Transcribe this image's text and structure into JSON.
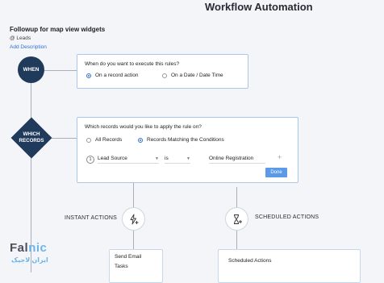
{
  "header": {
    "title": "Workflow Automation"
  },
  "rule": {
    "name": "Followup for map view widgets",
    "module": "@ Leads",
    "add_description": "Add Description"
  },
  "when": {
    "node_label": "WHEN",
    "question": "When do you want to execute this rules?",
    "options": [
      {
        "label": "On a record action",
        "selected": true
      },
      {
        "label": "On a Date / Date Time",
        "selected": false
      }
    ]
  },
  "which_records": {
    "node_label_line1": "WHICH",
    "node_label_line2": "RECORDS",
    "question": "Which records would you like to apply the rule on?",
    "options": [
      {
        "label": "All Records",
        "selected": false
      },
      {
        "label": "Records Matching the Conditions",
        "selected": true
      }
    ],
    "condition": {
      "number": "1",
      "field": "Lead Source",
      "operator": "is",
      "value": "Online Registration"
    },
    "add_label": "+",
    "done_label": "Done"
  },
  "instant_actions": {
    "label": "INSTANT ACTIONS",
    "items": [
      "Send Email",
      "Tasks"
    ]
  },
  "scheduled_actions": {
    "label": "SCHEDULED ACTIONS",
    "items": [
      "Scheduled Actions"
    ]
  },
  "watermark": {
    "latin_part1": "Fal",
    "latin_part2": "nic",
    "persian": "ایران لاجیک"
  },
  "colors": {
    "node": "#203a5c",
    "accent": "#2f6fcf",
    "done": "#5a9ae6",
    "border": "#a9c7ec"
  }
}
